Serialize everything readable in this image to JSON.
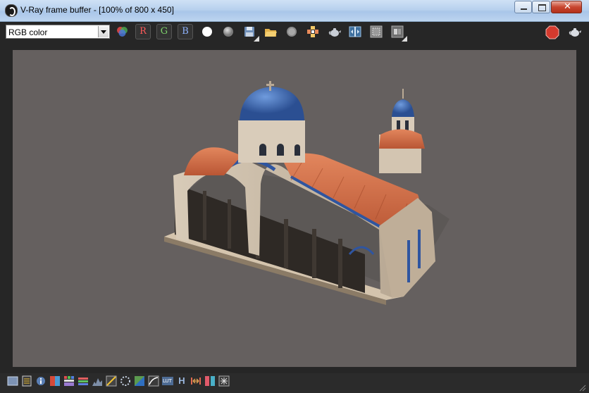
{
  "window": {
    "title": "V-Ray frame buffer - [100% of 800 x 450]"
  },
  "toolbar": {
    "channel": {
      "selected": "RGB color"
    },
    "red_label": "R",
    "green_label": "G",
    "blue_label": "B",
    "icons": [
      "channels-icon",
      "white-circle-icon",
      "gray-circle-icon",
      "save-icon",
      "open-folder-icon",
      "clear-image-icon",
      "track-mouse-icon",
      "teapot-render-icon",
      "compare-ab-icon",
      "region-render-icon",
      "link-to-vfb-icon",
      "stop-icon",
      "teapot-render-last-icon"
    ],
    "stop_label": "STOP"
  },
  "bottom_toolbar": {
    "icons": [
      "display-correction-icon",
      "color-clamp-icon",
      "info-icon",
      "lut-icon",
      "pixel-aspect-icon",
      "stereo-icon",
      "histogram-icon",
      "level-adjust-icon",
      "curve-icon",
      "exposure-icon",
      "white-balance-icon",
      "hsl-icon",
      "color-balance-icon",
      "ocio-icon",
      "background-icon",
      "lens-effects-icon"
    ],
    "h_label": "H",
    "lut_label": "LUT"
  }
}
